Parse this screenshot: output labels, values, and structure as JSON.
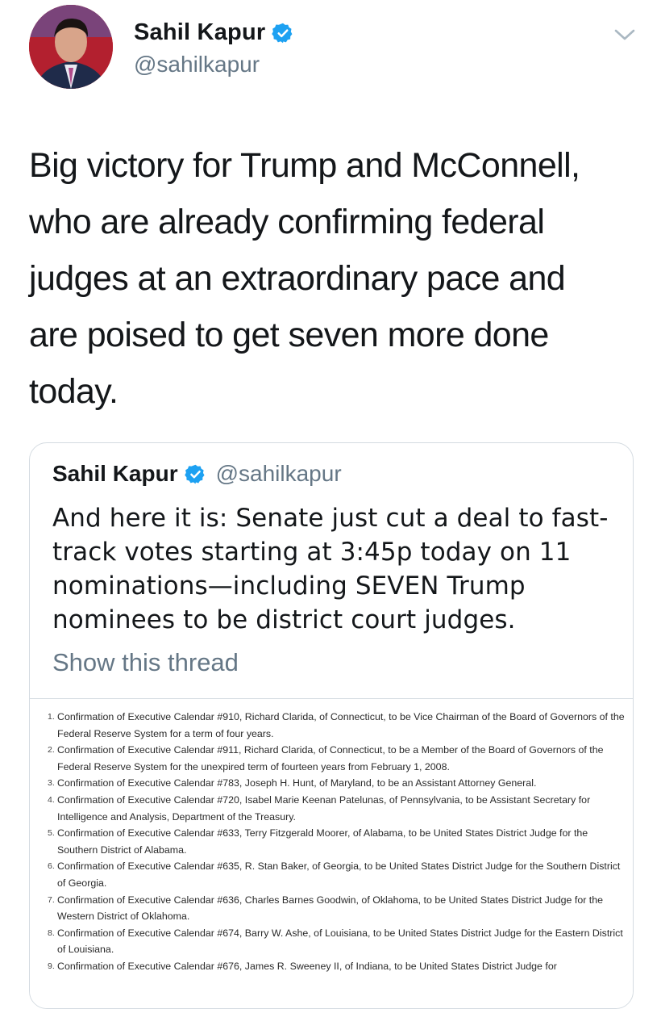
{
  "author": {
    "name": "Sahil Kapur",
    "handle": "@sahilkapur",
    "verified": true,
    "avatar": "avatar-photo"
  },
  "tweet": {
    "text": "Big victory for Trump and McConnell,\nwho are already confirming federal\njudges at an extraordinary pace and\nare poised to get seven more done\ntoday."
  },
  "quoted": {
    "name": "Sahil Kapur",
    "handle": "@sahilkapur",
    "text": "And here it is: Senate just cut a deal to fast-track votes starting at 3:45p today on 11 nominations—including SEVEN Trump nominees to be district court judges.",
    "show_thread": "Show this thread"
  },
  "document": {
    "items": [
      {
        "num": "1.",
        "text": "Confirmation of Executive Calendar #910, Richard Clarida, of Connecticut, to be Vice Chairman of the Board of Governors of the Federal Reserve System for a term of four years."
      },
      {
        "num": "2.",
        "text": "Confirmation of Executive Calendar #911, Richard Clarida, of Connecticut, to be a Member of the Board of Governors of the Federal Reserve System for the unexpired term of fourteen years from February 1, 2008."
      },
      {
        "num": "3.",
        "text": "Confirmation of Executive Calendar #783, Joseph H. Hunt, of Maryland, to be an Assistant Attorney General."
      },
      {
        "num": "4.",
        "text": "Confirmation of Executive Calendar #720, Isabel Marie Keenan Patelunas, of Pennsylvania, to be Assistant Secretary for Intelligence and Analysis, Department of the Treasury."
      },
      {
        "num": "5.",
        "text": "Confirmation of Executive Calendar #633, Terry Fitzgerald Moorer, of Alabama, to be United States District Judge for the Southern District of Alabama."
      },
      {
        "num": "6.",
        "text": "Confirmation of Executive Calendar #635, R. Stan Baker, of Georgia, to be United States District Judge for the Southern District of Georgia."
      },
      {
        "num": "7.",
        "text": "Confirmation of Executive Calendar #636, Charles Barnes Goodwin, of Oklahoma, to be United States District Judge for the Western District of Oklahoma."
      },
      {
        "num": "8.",
        "text": "Confirmation of Executive Calendar #674, Barry W. Ashe, of Louisiana, to be United States District Judge for the Eastern District of Louisiana."
      },
      {
        "num": "9.",
        "text": "Confirmation of Executive Calendar #676, James R. Sweeney II, of Indiana, to be United States District Judge for"
      }
    ]
  },
  "colors": {
    "text": "#14171a",
    "secondary": "#657786",
    "verified_blue": "#1da1f2",
    "border": "#d4dbe1"
  }
}
